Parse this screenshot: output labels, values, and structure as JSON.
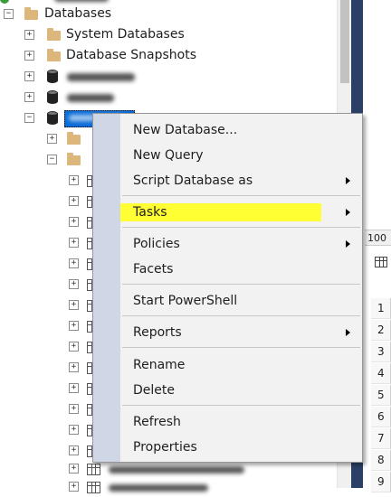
{
  "tree": {
    "root": {
      "label": "Databases",
      "expander": "−"
    },
    "items": [
      {
        "label": "System Databases",
        "expander": "+"
      },
      {
        "label": "Database Snapshots",
        "expander": "+"
      }
    ],
    "child_expanders": [
      "+",
      "+",
      "−"
    ],
    "sub_expanders": [
      "+",
      "−"
    ],
    "table_expanders": [
      "+",
      "+",
      "+",
      "+",
      "+",
      "+",
      "+",
      "+",
      "+",
      "+",
      "+",
      "+",
      "+",
      "+",
      "+",
      "+"
    ]
  },
  "context_menu": {
    "items": [
      {
        "label": "New Database...",
        "submenu": false
      },
      {
        "label": "New Query",
        "submenu": false
      },
      {
        "label": "Script Database as",
        "submenu": true
      },
      {
        "label": "Tasks",
        "submenu": true,
        "highlighted": true
      },
      {
        "label": "Policies",
        "submenu": true
      },
      {
        "label": "Facets",
        "submenu": false
      },
      {
        "label": "Start PowerShell",
        "submenu": false
      },
      {
        "label": "Reports",
        "submenu": true
      },
      {
        "label": "Rename",
        "submenu": false
      },
      {
        "label": "Delete",
        "submenu": false
      },
      {
        "label": "Refresh",
        "submenu": false
      },
      {
        "label": "Properties",
        "submenu": false
      }
    ],
    "highlight_color": "#ffff33"
  },
  "results": {
    "zoom": "100",
    "row_numbers": [
      "1",
      "2",
      "3",
      "4",
      "5",
      "6",
      "7",
      "8",
      "9"
    ]
  },
  "colors": {
    "accent": "#0a6cd6",
    "gutter": "#cfd6e5",
    "folder": "#dcb67a",
    "divider": "#2a4066"
  }
}
